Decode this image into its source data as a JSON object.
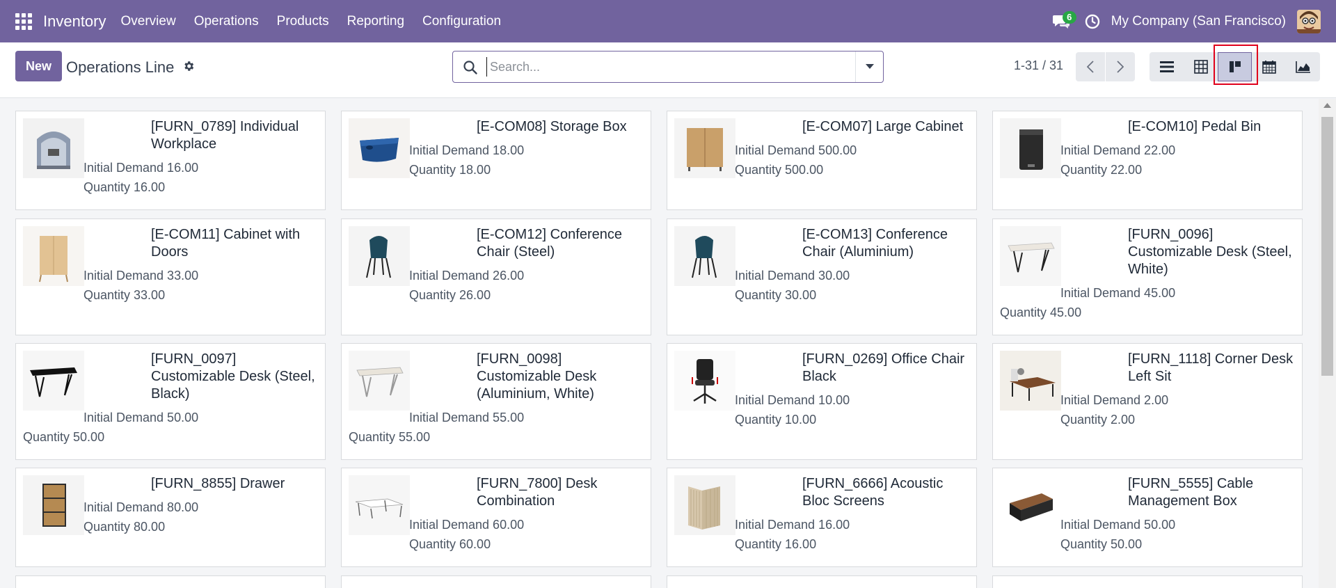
{
  "navbar": {
    "app_name": "Inventory",
    "menu": [
      "Overview",
      "Operations",
      "Products",
      "Reporting",
      "Configuration"
    ],
    "messages_count": "6",
    "company": "My Company (San Francisco)",
    "color": "#71639e"
  },
  "control": {
    "new_label": "New",
    "title": "Operations Line",
    "search_placeholder": "Search...",
    "pager": "1-31 / 31",
    "active_view": "kanban",
    "views": [
      "list-icon",
      "pivot-icon",
      "kanban-icon",
      "calendar-icon",
      "graph-icon"
    ]
  },
  "cards": [
    {
      "title": "[FURN_0789] Individual Workplace",
      "demand": "Initial Demand 16.00",
      "quantity": "Quantity 16.00",
      "image": "workplace-pod"
    },
    {
      "title": "[E-COM08] Storage Box",
      "demand": "Initial Demand 18.00",
      "quantity": "Quantity 18.00",
      "image": "blue-box"
    },
    {
      "title": "[E-COM07] Large Cabinet",
      "demand": "Initial Demand 500.00",
      "quantity": "Quantity 500.00",
      "image": "wood-cabinet"
    },
    {
      "title": "[E-COM10] Pedal Bin",
      "demand": "Initial Demand 22.00",
      "quantity": "Quantity 22.00",
      "image": "pedal-bin"
    },
    {
      "title": "[E-COM11] Cabinet with Doors",
      "demand": "Initial Demand 33.00",
      "quantity": "Quantity 33.00",
      "image": "cabinet-doors"
    },
    {
      "title": "[E-COM12] Conference Chair (Steel)",
      "demand": "Initial Demand 26.00",
      "quantity": "Quantity 26.00",
      "image": "teal-chair"
    },
    {
      "title": "[E-COM13] Conference Chair (Aluminium)",
      "demand": "Initial Demand 30.00",
      "quantity": "Quantity 30.00",
      "image": "teal-chair"
    },
    {
      "title": "[FURN_0096] Customizable Desk (Steel, White)",
      "demand": "Initial Demand 45.00",
      "quantity": "Quantity 45.00",
      "image": "white-desk"
    },
    {
      "title": "[FURN_0097] Customizable Desk (Steel, Black)",
      "demand": "Initial Demand 50.00",
      "quantity": "Quantity 50.00",
      "image": "black-desk"
    },
    {
      "title": "[FURN_0098] Customizable Desk (Aluminium, White)",
      "demand": "Initial Demand 55.00",
      "quantity": "Quantity 55.00",
      "image": "white-desk"
    },
    {
      "title": "[FURN_0269] Office Chair Black",
      "demand": "Initial Demand 10.00",
      "quantity": "Quantity 10.00",
      "image": "office-chair"
    },
    {
      "title": "[FURN_1118] Corner Desk Left Sit",
      "demand": "Initial Demand 2.00",
      "quantity": "Quantity 2.00",
      "image": "corner-desk"
    },
    {
      "title": "[FURN_8855] Drawer",
      "demand": "Initial Demand 80.00",
      "quantity": "Quantity 80.00",
      "image": "drawer"
    },
    {
      "title": "[FURN_7800] Desk Combination",
      "demand": "Initial Demand 60.00",
      "quantity": "Quantity 60.00",
      "image": "desk-combo"
    },
    {
      "title": "[FURN_6666] Acoustic Bloc Screens",
      "demand": "Initial Demand 16.00",
      "quantity": "Quantity 16.00",
      "image": "screens"
    },
    {
      "title": "[FURN_5555] Cable Management Box",
      "demand": "Initial Demand 50.00",
      "quantity": "Quantity 50.00",
      "image": "cable-box"
    }
  ]
}
